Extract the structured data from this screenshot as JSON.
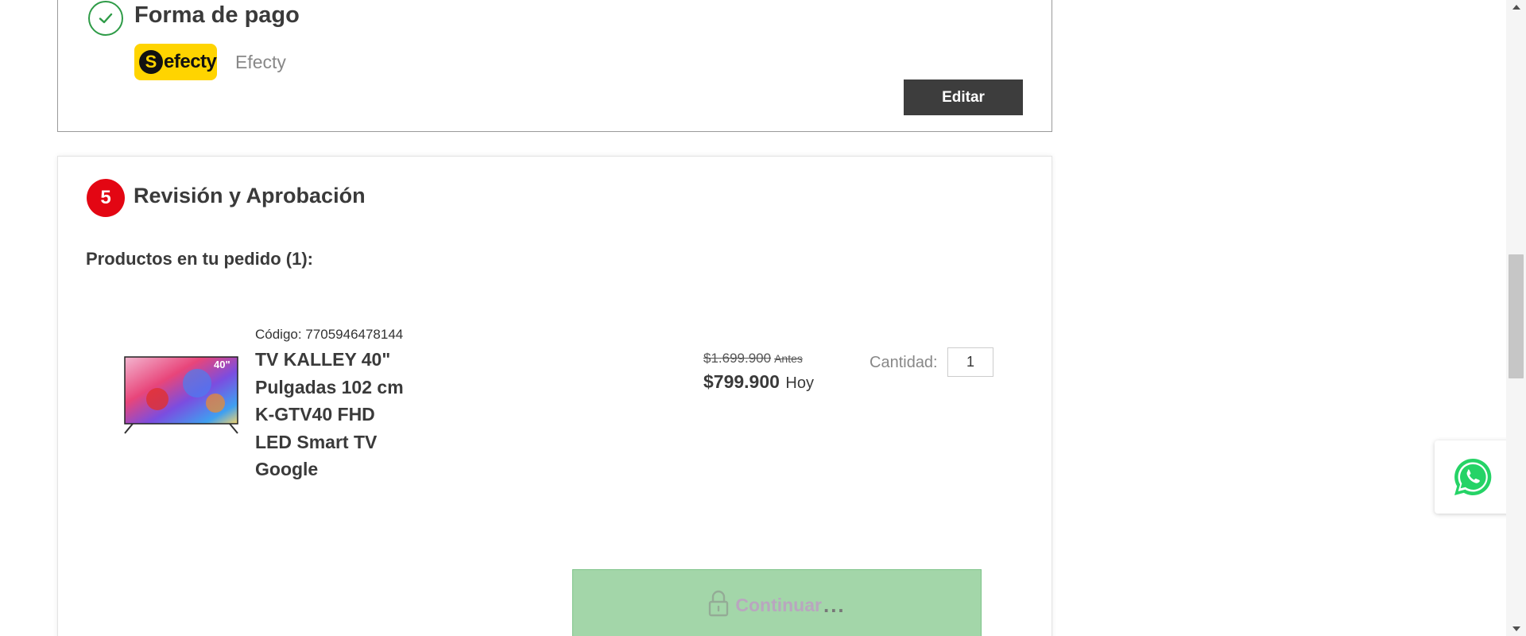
{
  "payment_section": {
    "title": "Forma de pago",
    "logo_text": "efecty",
    "logo_initial": "S",
    "method_name": "Efecty",
    "edit_label": "Editar"
  },
  "review_section": {
    "step_number": "5",
    "title": "Revisión y Aprobación",
    "products_heading": "Productos en tu pedido (1):"
  },
  "product": {
    "code_label": "Código:",
    "code_value": "7705946478144",
    "name": "TV KALLEY 40\" Pulgadas 102 cm K-GTV40 FHD LED Smart TV Google",
    "old_price": "$1.699.900",
    "old_price_suffix": "Antes",
    "price": "$799.900",
    "price_suffix": "Hoy",
    "quantity_label": "Cantidad:",
    "quantity_value": "1",
    "image_badge": "40\""
  },
  "continue_button": {
    "label": "Continuar",
    "dots": "..."
  },
  "colors": {
    "step_badge": "#e30613",
    "edit_button": "#3d3d3d",
    "continue_button": "#a3d6a9",
    "efecty_yellow": "#ffd400",
    "whatsapp_green": "#25d366",
    "check_green": "#2e9b47"
  },
  "icons": [
    "check-circle-icon",
    "lock-icon",
    "whatsapp-icon",
    "scroll-up-arrow-icon",
    "scroll-down-arrow-icon"
  ]
}
